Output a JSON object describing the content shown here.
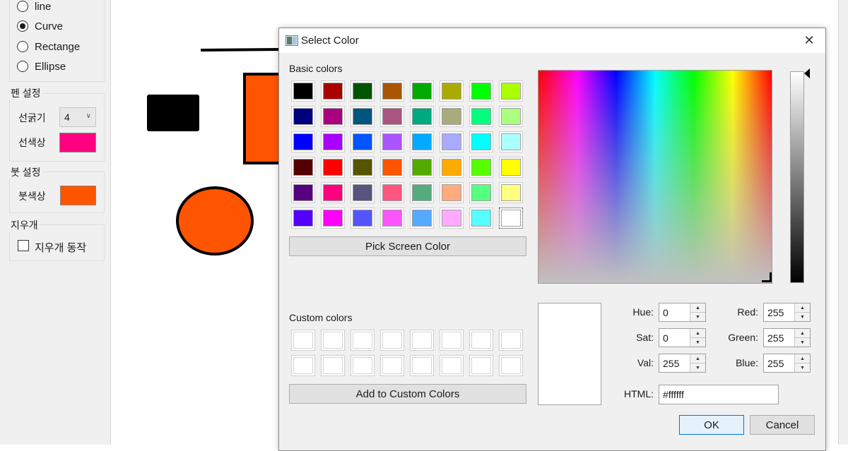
{
  "left_panel": {
    "shape_options": [
      "line",
      "Curve",
      "Rectange",
      "Ellipse"
    ],
    "selected_shape": "Curve",
    "pen_group_title": "펜 설정",
    "pen_width_label": "선굵기",
    "pen_width_value": "4",
    "pen_color_label": "선색상",
    "pen_color": "#ff0080",
    "brush_group_title": "붓 설정",
    "brush_color_label": "붓색상",
    "brush_color": "#ff5500",
    "eraser_group_title": "지우개",
    "eraser_checkbox_label": "지우개 동작",
    "eraser_checked": false
  },
  "canvas": {
    "shapes_colors": {
      "black_rect": "#000000",
      "orange_fill": "#ff5500",
      "stroke": "#000000"
    }
  },
  "dialog": {
    "title": "Select Color",
    "close_label": "✕",
    "basic_colors_label": "Basic colors",
    "basic_colors": [
      [
        "#000000",
        "#aa0000",
        "#005500",
        "#aa5500",
        "#00aa00",
        "#aaaa00",
        "#00ff00",
        "#aaff00"
      ],
      [
        "#00007f",
        "#aa007f",
        "#00557f",
        "#aa557f",
        "#00aa7f",
        "#aaaa7f",
        "#00ff7f",
        "#aaff7f"
      ],
      [
        "#0000ff",
        "#aa00ff",
        "#0055ff",
        "#aa55ff",
        "#00aaff",
        "#aaaaff",
        "#00ffff",
        "#aaffff"
      ],
      [
        "#550000",
        "#ff0000",
        "#555500",
        "#ff5500",
        "#55aa00",
        "#ffaa00",
        "#55ff00",
        "#ffff00"
      ],
      [
        "#55007f",
        "#ff007f",
        "#55557f",
        "#ff557f",
        "#55aa7f",
        "#ffaa7f",
        "#55ff7f",
        "#ffff7f"
      ],
      [
        "#5500ff",
        "#ff00ff",
        "#5555ff",
        "#ff55ff",
        "#55aaff",
        "#ffaaff",
        "#55ffff",
        "#ffffff"
      ]
    ],
    "selected_basic": "#ffffff",
    "pick_screen_label": "Pick Screen Color",
    "custom_colors_label": "Custom colors",
    "add_custom_label": "Add to Custom Colors",
    "fields": {
      "hue_label": "Hue:",
      "hue": "0",
      "sat_label": "Sat:",
      "sat": "0",
      "val_label": "Val:",
      "val": "255",
      "red_label": "Red:",
      "red": "255",
      "green_label": "Green:",
      "green": "255",
      "blue_label": "Blue:",
      "blue": "255",
      "html_label": "HTML:",
      "html": "#ffffff"
    },
    "ok_label": "OK",
    "cancel_label": "Cancel",
    "current_color": "#ffffff"
  }
}
